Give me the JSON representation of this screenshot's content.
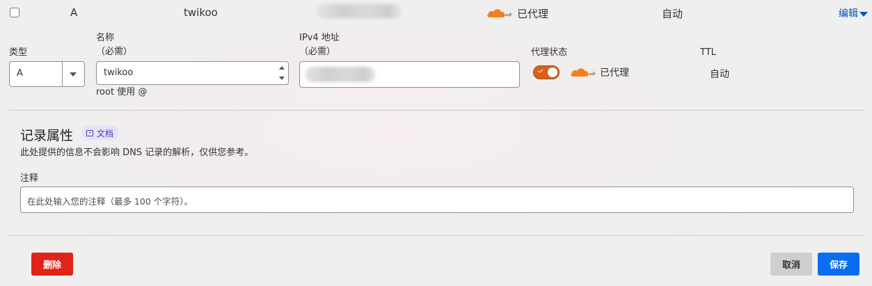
{
  "row": {
    "type": "A",
    "name": "twikoo",
    "proxy_status": "已代理",
    "ttl": "自动",
    "edit": "编辑"
  },
  "form": {
    "type_label": "类型",
    "type_value": "A",
    "name_label_1": "名称",
    "name_label_2": "（必需）",
    "name_value": "twikoo",
    "name_hint": "root 使用 @",
    "ipv4_label_1": "IPv4 地址",
    "ipv4_label_2": "（必需）",
    "proxy_label": "代理状态",
    "proxy_value": "已代理",
    "ttl_label": "TTL",
    "ttl_value": "自动"
  },
  "record_attributes": {
    "title": "记录属性",
    "doc_badge": "文档",
    "description": "此处提供的信息不会影响 DNS 记录的解析，仅供您参考。",
    "comment_label": "注释",
    "comment_placeholder": "在此处输入您的注释（最多 100 个字符）。"
  },
  "actions": {
    "delete": "删除",
    "cancel": "取消",
    "save": "保存"
  },
  "colors": {
    "cloud": "#f38020",
    "toggle": "#d7601a",
    "delete": "#e2231a",
    "save": "#0a6cf0",
    "link": "#0051c3"
  }
}
